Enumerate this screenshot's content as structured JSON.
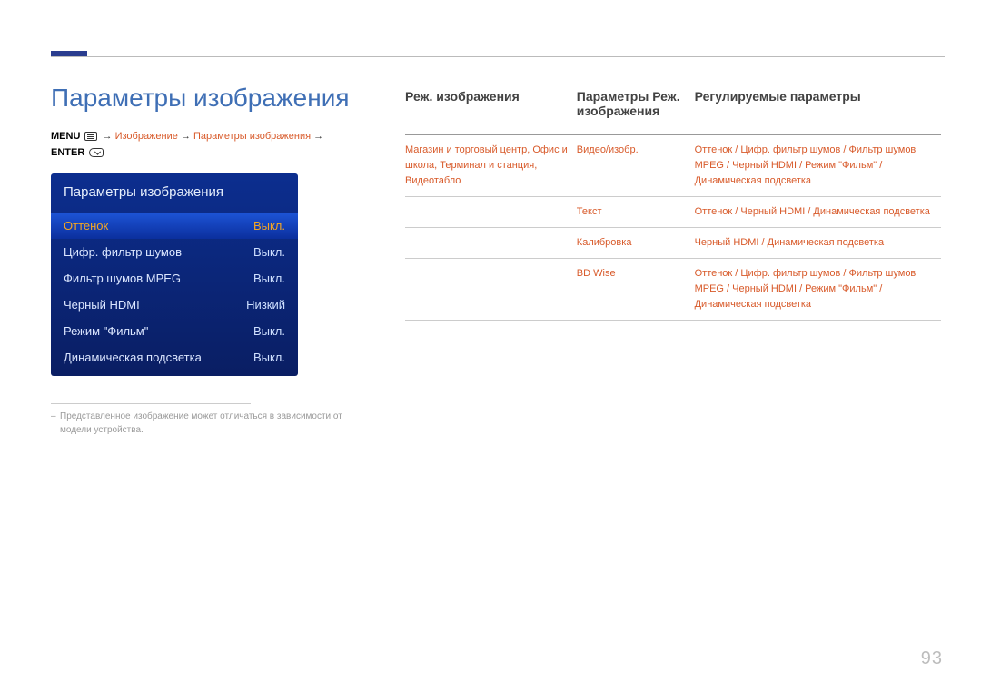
{
  "page_number": "93",
  "title": "Параметры изображения",
  "breadcrumb": {
    "menu_label": "MENU",
    "arrow": "→",
    "p1": "Изображение",
    "p2": "Параметры изображения",
    "enter_label": "ENTER"
  },
  "osd": {
    "title": "Параметры изображения",
    "rows": [
      {
        "label": "Оттенок",
        "value": "Выкл.",
        "selected": true
      },
      {
        "label": "Цифр. фильтр шумов",
        "value": "Выкл.",
        "selected": false
      },
      {
        "label": "Фильтр шумов MPEG",
        "value": "Выкл.",
        "selected": false
      },
      {
        "label": "Черный HDMI",
        "value": "Низкий",
        "selected": false
      },
      {
        "label": "Режим \"Фильм\"",
        "value": "Выкл.",
        "selected": false
      },
      {
        "label": "Динамическая подсветка",
        "value": "Выкл.",
        "selected": false
      }
    ]
  },
  "footnote": "Представленное изображение может отличаться в зависимости от модели устройства.",
  "table": {
    "headers": {
      "col1": "Реж. изображения",
      "col2": "Параметры Реж. изображения",
      "col3": "Регулируемые параметры"
    },
    "rows": [
      {
        "c1": "Магазин и торговый центр, Офис и школа, Терминал и станция, Видеотабло",
        "c2": "Видео/изобр.",
        "c3": "Оттенок / Цифр. фильтр шумов / Фильтр шумов MPEG / Черный HDMI / Режим \"Фильм\" / Динамическая подсветка"
      },
      {
        "c1": "",
        "c2": "Текст",
        "c3": "Оттенок / Черный HDMI / Динамическая подсветка"
      },
      {
        "c1": "",
        "c2": "Калибровка",
        "c3": "Черный HDMI / Динамическая подсветка"
      },
      {
        "c1": "",
        "c2": "BD Wise",
        "c3": "Оттенок / Цифр. фильтр шумов / Фильтр шумов MPEG / Черный HDMI / Режим \"Фильм\" / Динамическая подсветка"
      }
    ]
  }
}
